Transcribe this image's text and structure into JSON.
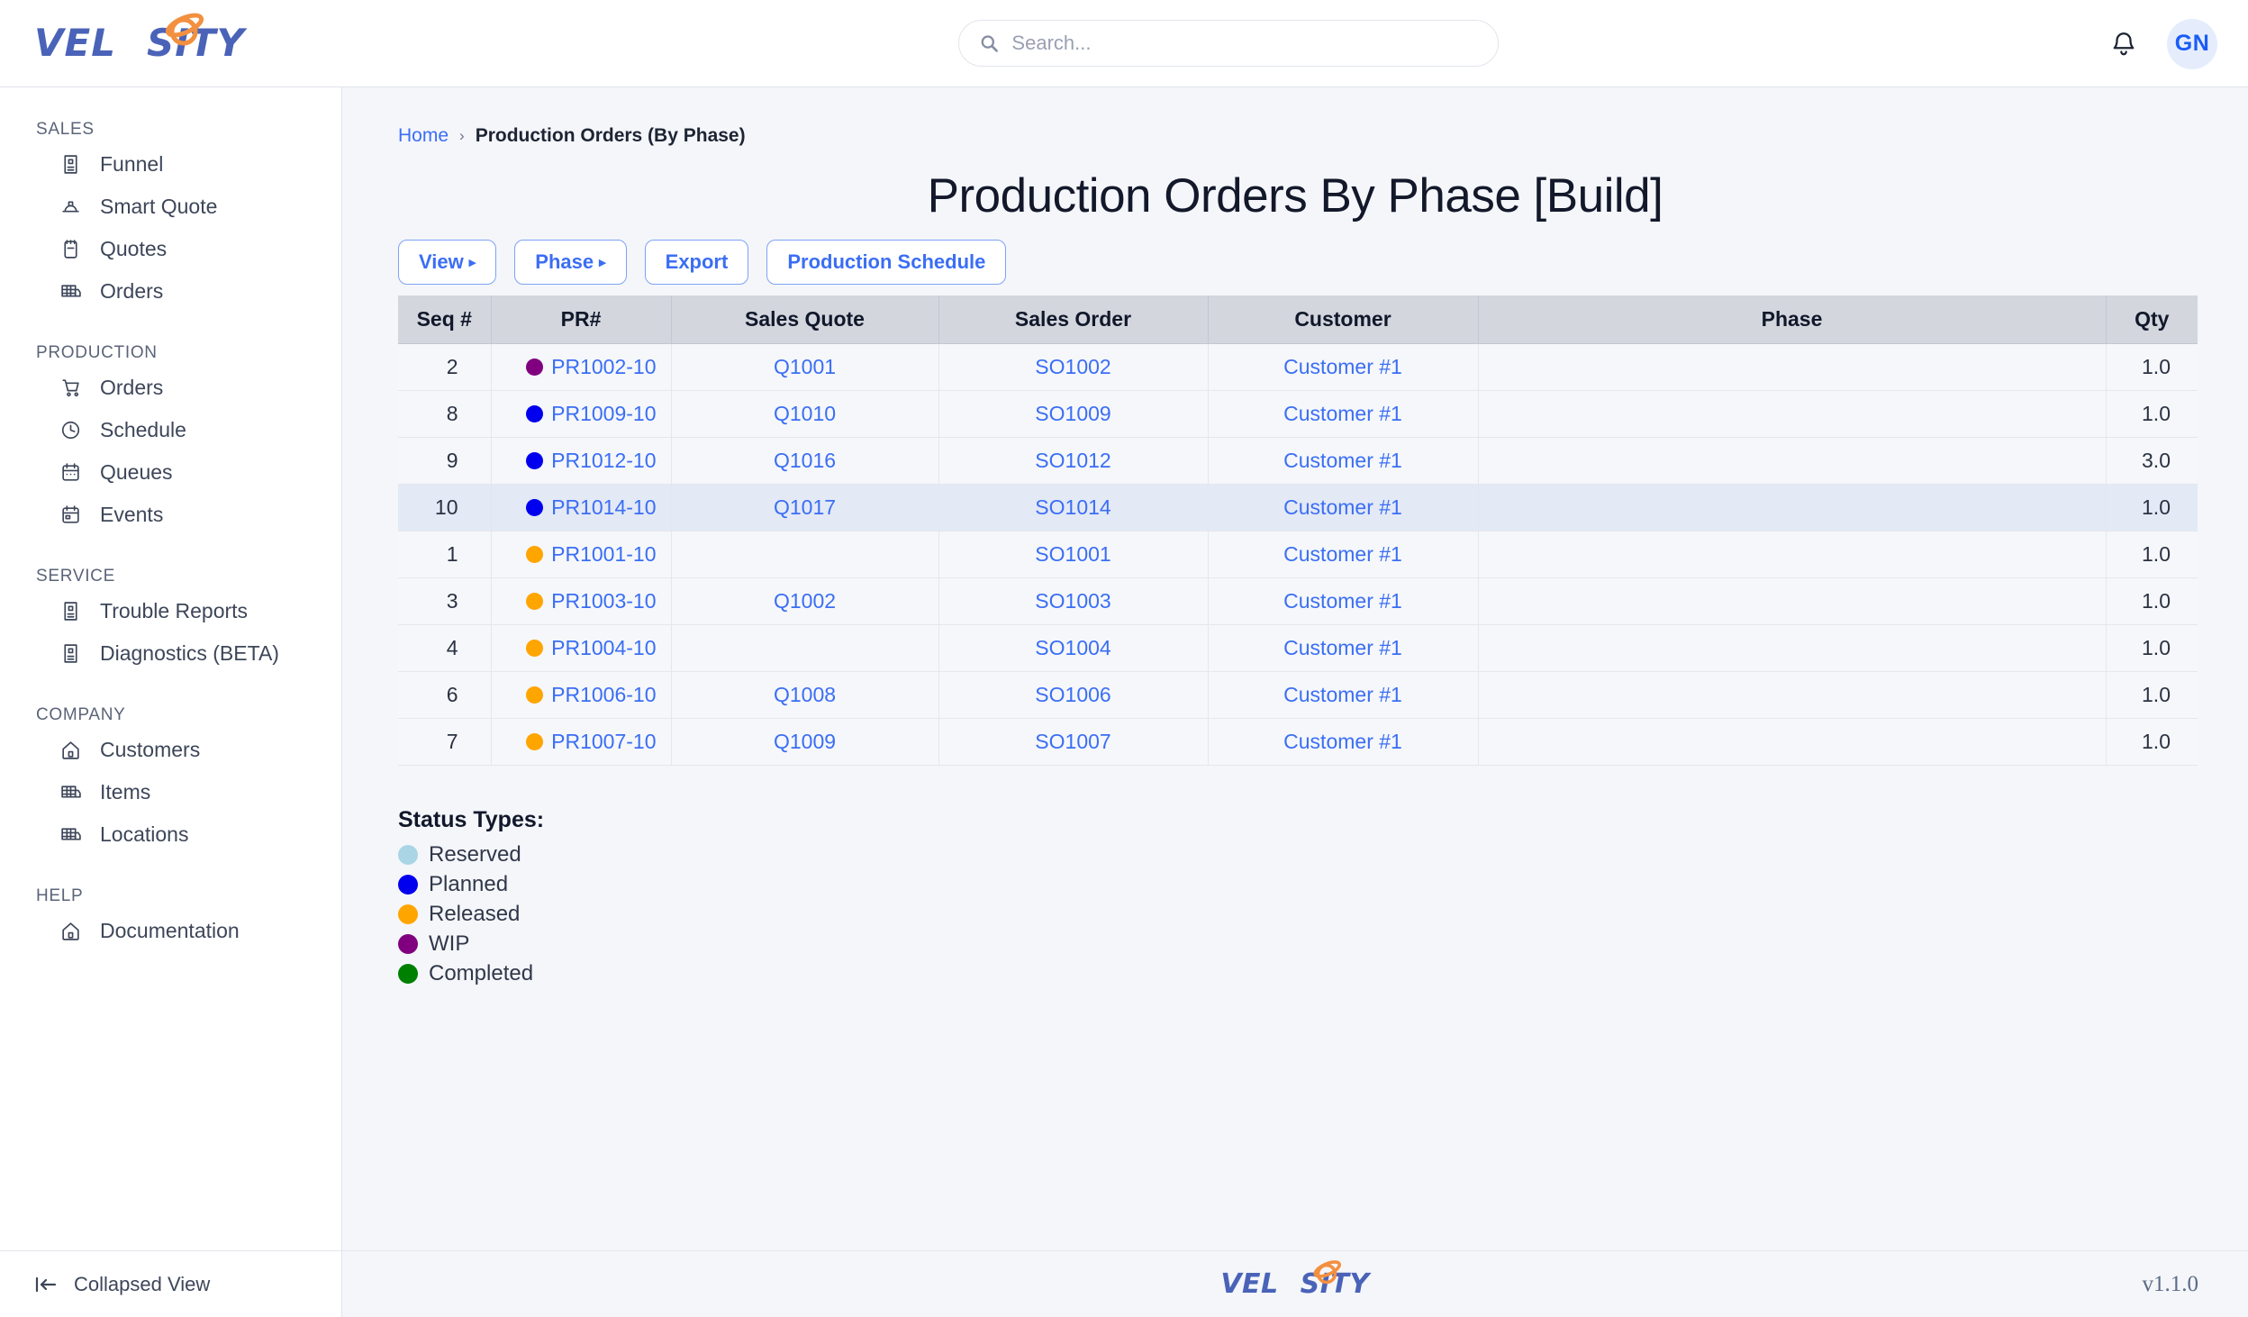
{
  "brand": {
    "name": "VELOSITY",
    "part_a": "VEL",
    "part_b": "SITY",
    "color_text": "#4a63b8",
    "color_accent": "#f39040"
  },
  "header": {
    "search_placeholder": "Search...",
    "search_value": "",
    "avatar_initials": "GN"
  },
  "sidebar": {
    "groups": [
      {
        "title": "SALES",
        "items": [
          {
            "label": "Funnel",
            "icon": "building-icon"
          },
          {
            "label": "Smart Quote",
            "icon": "hardhat-icon"
          },
          {
            "label": "Quotes",
            "icon": "clipboard-icon"
          },
          {
            "label": "Orders",
            "icon": "grid-truck-icon"
          }
        ]
      },
      {
        "title": "PRODUCTION",
        "items": [
          {
            "label": "Orders",
            "icon": "cart-icon"
          },
          {
            "label": "Schedule",
            "icon": "clock-icon"
          },
          {
            "label": "Queues",
            "icon": "calendar-icon"
          },
          {
            "label": "Events",
            "icon": "calendar-event-icon"
          }
        ]
      },
      {
        "title": "SERVICE",
        "items": [
          {
            "label": "Trouble Reports",
            "icon": "building-icon"
          },
          {
            "label": "Diagnostics (BETA)",
            "icon": "building-icon"
          }
        ]
      },
      {
        "title": "COMPANY",
        "items": [
          {
            "label": "Customers",
            "icon": "home-icon"
          },
          {
            "label": "Items",
            "icon": "grid-truck-icon"
          },
          {
            "label": "Locations",
            "icon": "grid-truck-icon"
          }
        ]
      },
      {
        "title": "HELP",
        "items": [
          {
            "label": "Documentation",
            "icon": "home-icon"
          }
        ]
      }
    ],
    "collapse_label": "Collapsed View"
  },
  "breadcrumb": {
    "home": "Home",
    "separator": "›",
    "current": "Production Orders (By Phase)"
  },
  "page": {
    "title": "Production Orders By Phase [Build]"
  },
  "toolbar": {
    "buttons": [
      {
        "label": "View",
        "caret": "▸"
      },
      {
        "label": "Phase",
        "caret": "▸"
      },
      {
        "label": "Export",
        "caret": ""
      },
      {
        "label": "Production Schedule",
        "caret": ""
      }
    ]
  },
  "table": {
    "columns": [
      "Seq #",
      "PR#",
      "Sales Quote",
      "Sales Order",
      "Customer",
      "Phase",
      "Qty"
    ],
    "rows": [
      {
        "seq": "2",
        "pr": "PR1002-10",
        "status_color": "#800080",
        "status": "WIP",
        "quote": "Q1001",
        "order": "SO1002",
        "customer": "Customer #1",
        "phase": "",
        "qty": "1.0",
        "selected": false
      },
      {
        "seq": "8",
        "pr": "PR1009-10",
        "status_color": "#0000ee",
        "status": "Planned",
        "quote": "Q1010",
        "order": "SO1009",
        "customer": "Customer #1",
        "phase": "",
        "qty": "1.0",
        "selected": false
      },
      {
        "seq": "9",
        "pr": "PR1012-10",
        "status_color": "#0000ee",
        "status": "Planned",
        "quote": "Q1016",
        "order": "SO1012",
        "customer": "Customer #1",
        "phase": "",
        "qty": "3.0",
        "selected": false
      },
      {
        "seq": "10",
        "pr": "PR1014-10",
        "status_color": "#0000ee",
        "status": "Planned",
        "quote": "Q1017",
        "order": "SO1014",
        "customer": "Customer #1",
        "phase": "",
        "qty": "1.0",
        "selected": true
      },
      {
        "seq": "1",
        "pr": "PR1001-10",
        "status_color": "#ffa500",
        "status": "Released",
        "quote": "",
        "order": "SO1001",
        "customer": "Customer #1",
        "phase": "",
        "qty": "1.0",
        "selected": false
      },
      {
        "seq": "3",
        "pr": "PR1003-10",
        "status_color": "#ffa500",
        "status": "Released",
        "quote": "Q1002",
        "order": "SO1003",
        "customer": "Customer #1",
        "phase": "",
        "qty": "1.0",
        "selected": false
      },
      {
        "seq": "4",
        "pr": "PR1004-10",
        "status_color": "#ffa500",
        "status": "Released",
        "quote": "",
        "order": "SO1004",
        "customer": "Customer #1",
        "phase": "",
        "qty": "1.0",
        "selected": false
      },
      {
        "seq": "6",
        "pr": "PR1006-10",
        "status_color": "#ffa500",
        "status": "Released",
        "quote": "Q1008",
        "order": "SO1006",
        "customer": "Customer #1",
        "phase": "",
        "qty": "1.0",
        "selected": false
      },
      {
        "seq": "7",
        "pr": "PR1007-10",
        "status_color": "#ffa500",
        "status": "Released",
        "quote": "Q1009",
        "order": "SO1007",
        "customer": "Customer #1",
        "phase": "",
        "qty": "1.0",
        "selected": false
      }
    ]
  },
  "legend": {
    "title": "Status Types:",
    "items": [
      {
        "label": "Reserved",
        "color": "#a9d5e5"
      },
      {
        "label": "Planned",
        "color": "#0000ee"
      },
      {
        "label": "Released",
        "color": "#ffa500"
      },
      {
        "label": "WIP",
        "color": "#800080"
      },
      {
        "label": "Completed",
        "color": "#008000"
      }
    ]
  },
  "footer": {
    "version": "v1.1.0"
  }
}
